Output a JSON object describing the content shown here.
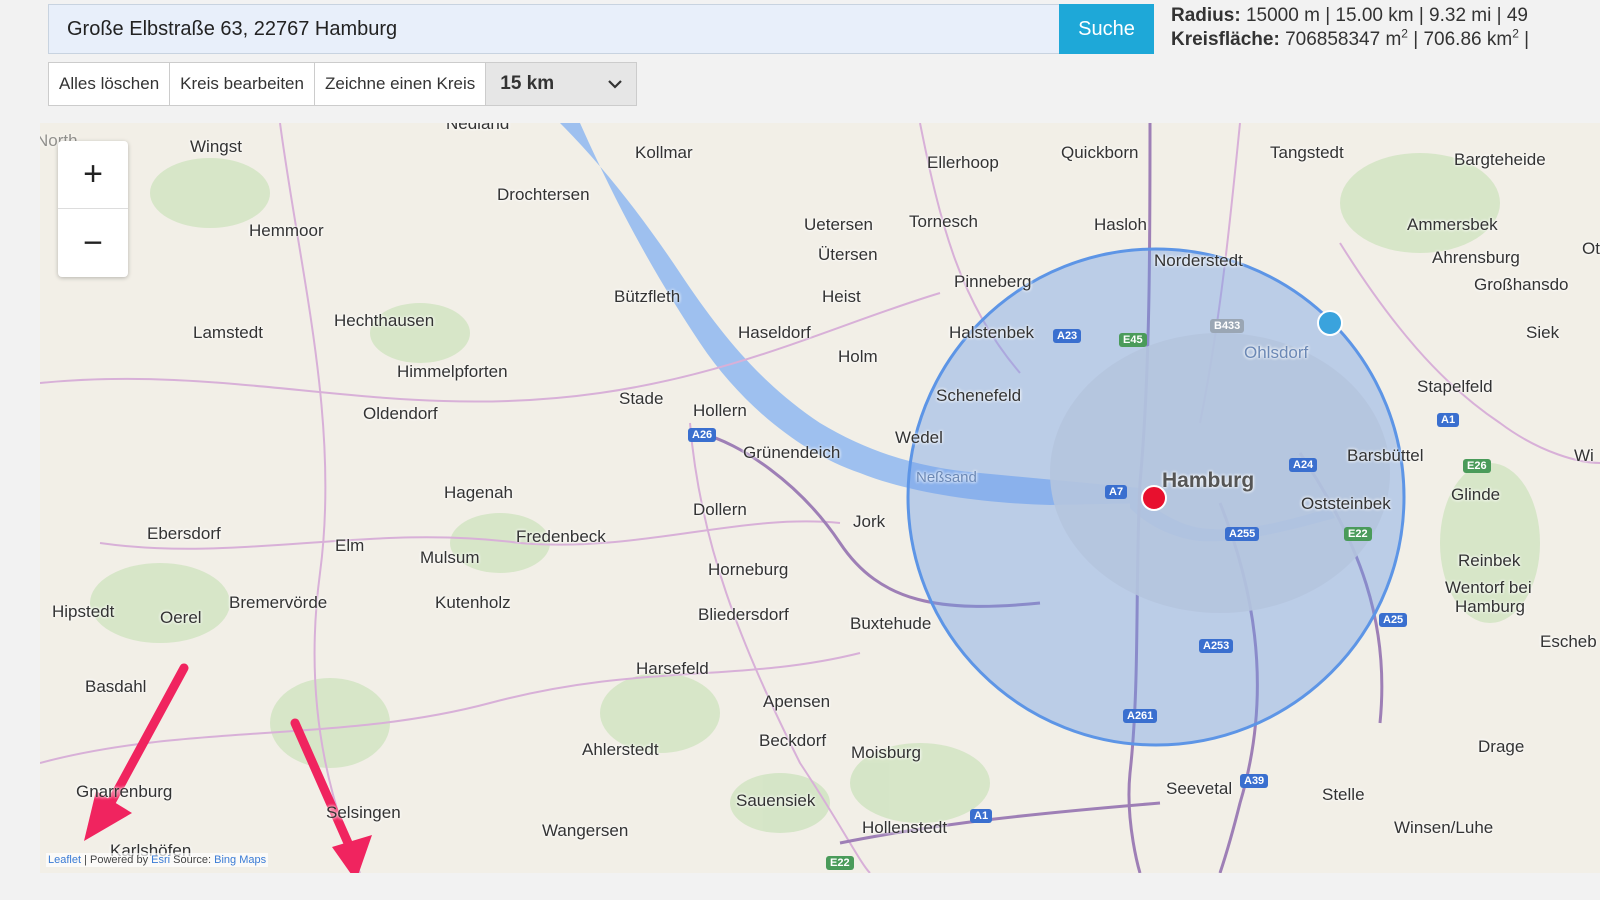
{
  "search": {
    "value": "Große Elbstraße 63, 22767 Hamburg",
    "button_label": "Suche"
  },
  "stats": {
    "radius_label": "Radius:",
    "radius_value": "15000 m | 15.00 km | 9.32 mi | 49",
    "area_label": "Kreisfläche:",
    "area_value_1": "706858347 m",
    "area_sup_1": "2",
    "area_value_2": " | 706.86 km",
    "area_sup_2": "2",
    "area_tail": " |"
  },
  "toolbar": {
    "clear_label": "Alles löschen",
    "edit_label": "Kreis bearbeiten",
    "draw_label": "Zeichne einen Kreis",
    "select_value": "15 km"
  },
  "map": {
    "zoom_in": "+",
    "zoom_out": "−",
    "colors": {
      "land": "#f2efe7",
      "water": "#9ec0ef",
      "circle_fill": "#6f9ee8",
      "circle_stroke": "#5d95e6",
      "marker": "#e8102e",
      "handle": "#3aa3dd",
      "arrow": "#f0245f"
    },
    "places": [
      {
        "name": "Kollmar"
      },
      {
        "name": "Ellerhoop"
      },
      {
        "name": "Quickborn"
      },
      {
        "name": "Tangstedt"
      },
      {
        "name": "Bargteheide"
      },
      {
        "name": "Wingst"
      },
      {
        "name": "Drochtersen"
      },
      {
        "name": "Uetersen"
      },
      {
        "name": "Tornesch"
      },
      {
        "name": "Hasloh"
      },
      {
        "name": "Ammersbek"
      },
      {
        "name": "Hemmoor"
      },
      {
        "name": "Ütersen"
      },
      {
        "name": "Norderstedt"
      },
      {
        "name": "Ahrensburg"
      },
      {
        "name": "Pinneberg"
      },
      {
        "name": "Großhansdo"
      },
      {
        "name": "Bützfleth"
      },
      {
        "name": "Heist"
      },
      {
        "name": "Lamstedt"
      },
      {
        "name": "Hechthausen"
      },
      {
        "name": "Haseldorf"
      },
      {
        "name": "Halstenbek"
      },
      {
        "name": "Ohlsdorf"
      },
      {
        "name": "Siek"
      },
      {
        "name": "Holm"
      },
      {
        "name": "Himmelpforten"
      },
      {
        "name": "Stapelfeld"
      },
      {
        "name": "Stade"
      },
      {
        "name": "Schenefeld"
      },
      {
        "name": "Oldendorf"
      },
      {
        "name": "Hollern"
      },
      {
        "name": "Wedel"
      },
      {
        "name": "Grünendeich"
      },
      {
        "name": "Barsbüttel"
      },
      {
        "name": "Neßsand"
      },
      {
        "name": "Hamburg"
      },
      {
        "name": "Hagenah"
      },
      {
        "name": "Glinde"
      },
      {
        "name": "Oststeinbek"
      },
      {
        "name": "Dollern"
      },
      {
        "name": "Jork"
      },
      {
        "name": "Ebersdorf"
      },
      {
        "name": "Elm"
      },
      {
        "name": "Fredenbeck"
      },
      {
        "name": "Mulsum"
      },
      {
        "name": "Reinbek"
      },
      {
        "name": "Horneburg"
      },
      {
        "name": "Wentorf bei"
      },
      {
        "name": "Hamburg"
      },
      {
        "name": "Hipstedt"
      },
      {
        "name": "Bremervörde"
      },
      {
        "name": "Kutenholz"
      },
      {
        "name": "Oerel"
      },
      {
        "name": "Bliedersdorf"
      },
      {
        "name": "Buxtehude"
      },
      {
        "name": "Escheb"
      },
      {
        "name": "Basdahl"
      },
      {
        "name": "Harsefeld"
      },
      {
        "name": "Apensen"
      },
      {
        "name": "Ahlerstedt"
      },
      {
        "name": "Beckdorf"
      },
      {
        "name": "Moisburg"
      },
      {
        "name": "Drage"
      },
      {
        "name": "Seevetal"
      },
      {
        "name": "Stelle"
      },
      {
        "name": "Gnarrenburg"
      },
      {
        "name": "Sauensiek"
      },
      {
        "name": "Selsingen"
      },
      {
        "name": "Wangersen"
      },
      {
        "name": "Hollenstedt"
      },
      {
        "name": "Winsen/Luhe"
      },
      {
        "name": "Karlshöfen"
      },
      {
        "name": "Nedland"
      },
      {
        "name": "North"
      },
      {
        "name": "Wi"
      },
      {
        "name": "Ot"
      }
    ],
    "shields": [
      {
        "label": "A23"
      },
      {
        "label": "E45"
      },
      {
        "label": "B433"
      },
      {
        "label": "A26"
      },
      {
        "label": "A1"
      },
      {
        "label": "A7"
      },
      {
        "label": "A24"
      },
      {
        "label": "E26"
      },
      {
        "label": "A255"
      },
      {
        "label": "E22"
      },
      {
        "label": "A25"
      },
      {
        "label": "A253"
      },
      {
        "label": "A261"
      },
      {
        "label": "A39"
      },
      {
        "label": "A1"
      },
      {
        "label": "E22"
      }
    ],
    "attribution": {
      "leaflet": "Leaflet",
      "sep": " | Powered by ",
      "esri": "Esri",
      "source": " Source: ",
      "bing": "Bing Maps"
    }
  }
}
